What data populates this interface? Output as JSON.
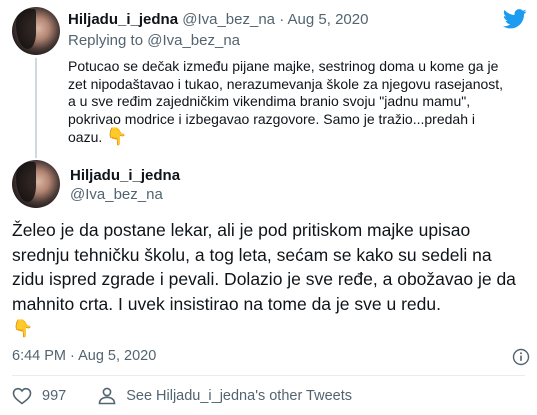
{
  "tweet1": {
    "name": "Hiljadu_i_jedna",
    "handle": "@Iva_bez_na",
    "separator": "·",
    "date": "Aug 5, 2020",
    "replying_prefix": "Replying to",
    "replying_to": "@Iva_bez_na",
    "body": "Potucao se dečak između pijane majke, sestrinog doma u kome ga je zet nipodaštavao i tukao, nerazumevanja škole za njegovu rasejanost, a u sve ređim zajedničkim vikendima branio svoju \"jadnu mamu\", pokrivao modrice i izbegavao razgovore. Samo je tražio...predah i oazu.",
    "emoji": "👇"
  },
  "tweet2": {
    "name": "Hiljadu_i_jedna",
    "handle": "@Iva_bez_na",
    "body": "Želeo je da postane lekar, ali je pod pritiskom majke upisao srednju tehničku školu, a tog leta, sećam se kako su sedeli na zidu ispred zgrade i pevali. Dolazio je sve ređe, a obožavao je da mahnito crta. I uvek insistirao na tome da je sve u redu.",
    "emoji": "👇",
    "timestamp": "6:44 PM · Aug 5, 2020"
  },
  "actions": {
    "like_count": "997",
    "other_tweets_label": "See Hiljadu_i_jedna's other Tweets"
  },
  "colors": {
    "twitter_blue": "#1d9bf0",
    "secondary_text": "#536471",
    "primary_text": "#0f1419"
  },
  "icons": {
    "logo": "twitter-bird-icon",
    "info": "info-icon",
    "like": "heart-icon",
    "profile": "person-icon"
  }
}
